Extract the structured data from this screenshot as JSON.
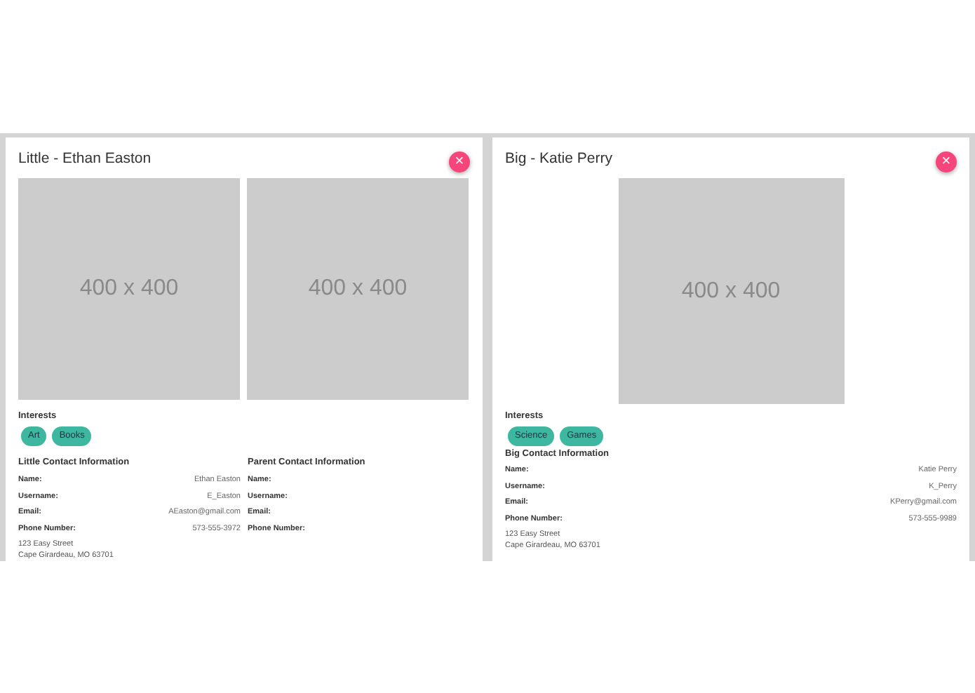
{
  "cards": [
    {
      "title": "Little - Ethan Easton",
      "close": "×",
      "images": [
        {
          "text": "400 x 400"
        },
        {
          "text": "400 x 400"
        }
      ],
      "interests_label": "Interests",
      "interests": [
        "Art",
        "Books"
      ],
      "sections": [
        {
          "heading": "Little Contact Information",
          "fields": [
            {
              "label": "Name:",
              "value": "Ethan Easton"
            },
            {
              "label": "Username:",
              "value": "E_Easton"
            },
            {
              "label": "Email:",
              "value": "AEaston@gmail.com"
            },
            {
              "label": "Phone Number:",
              "value": "573-555-3972"
            }
          ],
          "address": [
            "123 Easy Street",
            "Cape Girardeau, MO 63701"
          ]
        },
        {
          "heading": "Parent Contact Information",
          "fields": [
            {
              "label": "Name:"
            },
            {
              "label": "Username:"
            },
            {
              "label": "Email:"
            },
            {
              "label": "Phone Number:"
            }
          ]
        }
      ]
    },
    {
      "title": "Big - Katie Perry",
      "close": "×",
      "images": [
        {
          "text": "400 x 400"
        }
      ],
      "interests_label": "Interests",
      "interests": [
        "Science",
        "Games"
      ],
      "sections": [
        {
          "heading": "Big Contact Information",
          "fields": [
            {
              "label": "Name:",
              "value": "Katie Perry"
            },
            {
              "label": "Username:",
              "value": "K_Perry"
            },
            {
              "label": "Email:",
              "value": "KPerry@gmail.com"
            },
            {
              "label": "Phone Number:",
              "value": "573-555-9989"
            }
          ],
          "address": [
            "123 Easy Street",
            "Cape Girardeau, MO 63701"
          ]
        }
      ]
    }
  ]
}
